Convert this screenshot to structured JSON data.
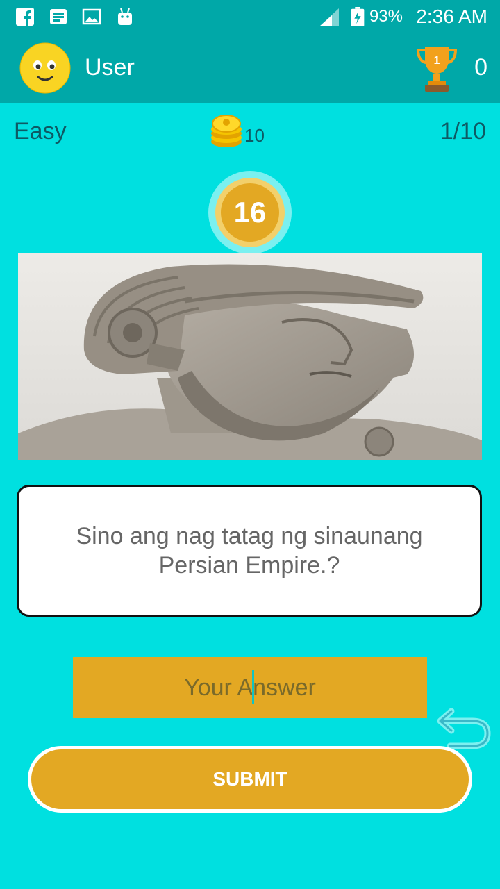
{
  "status_bar": {
    "battery_percent": "93%",
    "time": "2:36 AM",
    "icons": [
      "facebook-icon",
      "news-icon",
      "gallery-icon",
      "android-icon",
      "signal-icon",
      "battery-charging-icon"
    ]
  },
  "header": {
    "username": "User",
    "score": "0",
    "avatar": "smiley-face-icon",
    "trophy": "trophy-icon"
  },
  "info": {
    "difficulty": "Easy",
    "coins": "10",
    "progress": "1/10"
  },
  "timer": {
    "value": "16"
  },
  "question": {
    "text": "Sino ang nag tatag ng sinaunang Persian Empire.?"
  },
  "answer": {
    "placeholder": "Your Answer"
  },
  "actions": {
    "submit_label": "SUBMIT"
  },
  "colors": {
    "background": "#00E0E0",
    "header": "#00A8A8",
    "accent": "#E3A823"
  }
}
